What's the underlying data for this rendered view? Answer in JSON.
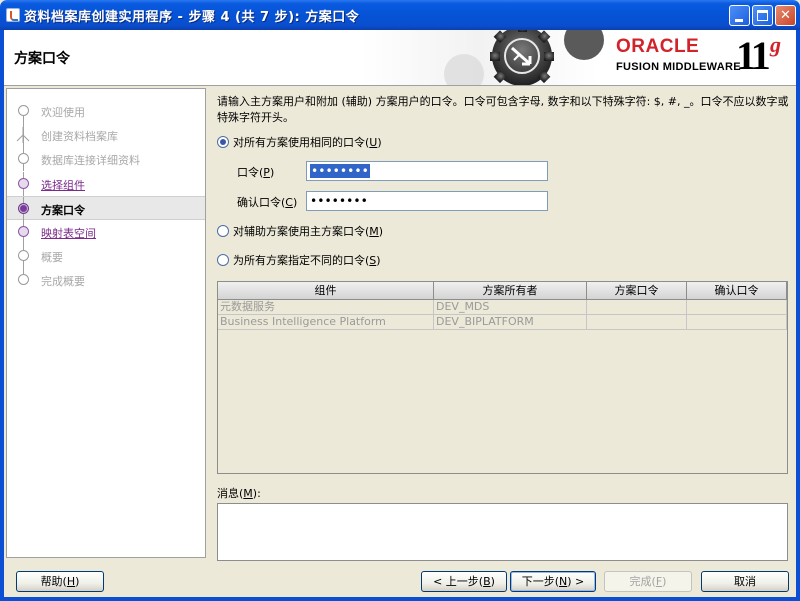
{
  "window": {
    "title": "资料档案库创建实用程序 - 步骤 4 (共 7 步): 方案口令"
  },
  "header": {
    "heading": "方案口令",
    "brand_oracle": "ORACLE",
    "brand_product": "FUSION MIDDLEWARE",
    "brand_version": "11",
    "brand_version_suffix": "g"
  },
  "steps": [
    {
      "label": "欢迎使用",
      "state": "done"
    },
    {
      "label": "创建资料档案库",
      "state": "done"
    },
    {
      "label": "数据库连接详细资料",
      "state": "done"
    },
    {
      "label": "选择组件",
      "state": "link"
    },
    {
      "label": "方案口令",
      "state": "current"
    },
    {
      "label": "映射表空间",
      "state": "link"
    },
    {
      "label": "概要",
      "state": "pending"
    },
    {
      "label": "完成概要",
      "state": "pending"
    }
  ],
  "content": {
    "instructions": "请输入主方案用户和附加 (辅助) 方案用户的口令。口令可包含字母, 数字和以下特殊字符: $, #, _。口令不应以数字或特殊字符开头。",
    "option_same": {
      "text": "对所有方案使用相同的口令(",
      "mnemonic": "U",
      "close": ")",
      "checked": true
    },
    "password_label": {
      "text": "口令(",
      "mnemonic": "P",
      "close": ")"
    },
    "password_value": "••••••••",
    "confirm_label": {
      "text": "确认口令(",
      "mnemonic": "C",
      "close": ")"
    },
    "confirm_value": "••••••••",
    "option_aux": {
      "text": "对辅助方案使用主方案口令(",
      "mnemonic": "M",
      "close": ")",
      "checked": false
    },
    "option_diff": {
      "text": "为所有方案指定不同的口令(",
      "mnemonic": "S",
      "close": ")",
      "checked": false
    }
  },
  "table": {
    "columns": [
      "组件",
      "方案所有者",
      "方案口令",
      "确认口令"
    ],
    "rows": [
      [
        "元数据服务",
        "DEV_MDS",
        "",
        ""
      ],
      [
        "Business Intelligence Platform",
        "DEV_BIPLATFORM",
        "",
        ""
      ]
    ]
  },
  "messages": {
    "label_text": "消息(",
    "label_mnemonic": "M",
    "label_close": "):"
  },
  "buttons": {
    "help": {
      "text": "帮助(",
      "mnemonic": "H",
      "close": ")"
    },
    "back": {
      "text": "< 上一步(",
      "mnemonic": "B",
      "close": ")"
    },
    "next": {
      "text": "下一步(",
      "mnemonic": "N",
      "close": ") >"
    },
    "finish": {
      "text": "完成(",
      "mnemonic": "F",
      "close": ")"
    },
    "cancel": {
      "text": "取消"
    }
  },
  "colors": {
    "titlebar": "#0553d6",
    "oracle_red": "#d2232a",
    "step_link": "#7a2a8a"
  },
  "icons": [
    "java-app-icon",
    "minimize-icon",
    "maximize-icon",
    "close-icon",
    "gear-logo-icon"
  ]
}
